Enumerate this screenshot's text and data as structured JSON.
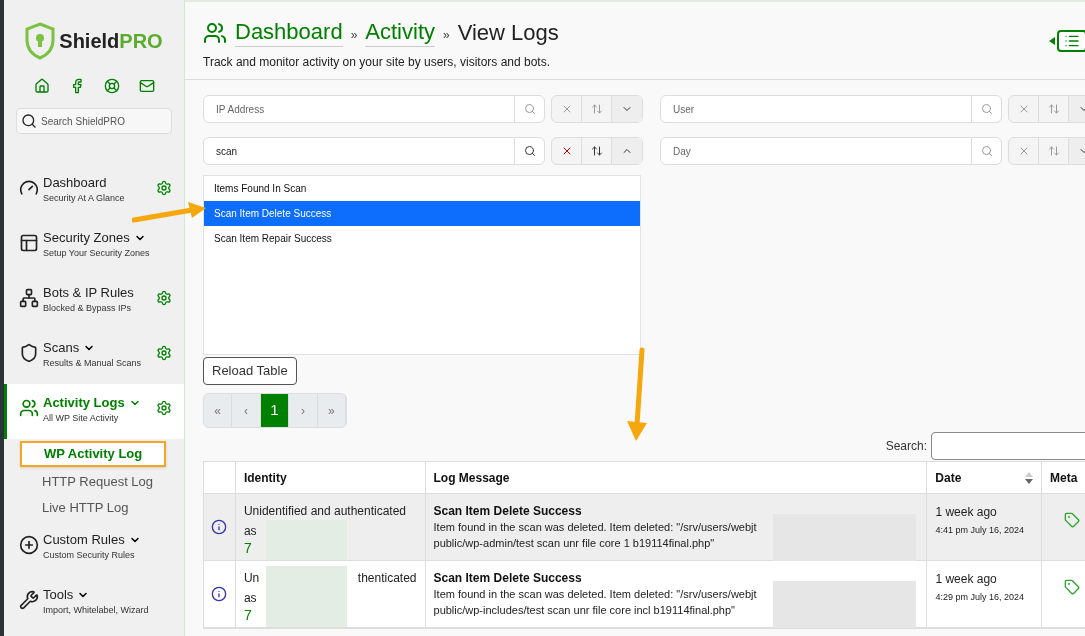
{
  "brand": {
    "name_start": "Shield",
    "name_end": "PRO"
  },
  "sidebar": {
    "search_placeholder": "Search ShieldPRO",
    "items": [
      {
        "kind": "gauge",
        "title": "Dashboard",
        "subtitle": "Security At A Glance",
        "dropdown": false,
        "settings": true,
        "selected": false
      },
      {
        "kind": "zones",
        "title": "Security Zones",
        "subtitle": "Setup Your Security Zones",
        "dropdown": true,
        "settings": false,
        "selected": false
      },
      {
        "kind": "network",
        "title": "Bots & IP Rules",
        "subtitle": "Blocked & Bypass IPs",
        "dropdown": false,
        "settings": true,
        "selected": false
      },
      {
        "kind": "shield",
        "title": "Scans",
        "subtitle": "Results & Manual Scans",
        "dropdown": true,
        "settings": true,
        "selected": false
      },
      {
        "kind": "users",
        "title": "Activity Logs",
        "subtitle": "All WP Site Activity",
        "dropdown": true,
        "settings": true,
        "selected": true,
        "children": [
          {
            "label": "WP Activity Log",
            "selected": true
          },
          {
            "label": "HTTP Request Log",
            "selected": false
          },
          {
            "label": "Live HTTP Log",
            "selected": false
          }
        ]
      },
      {
        "kind": "rules",
        "title": "Custom Rules",
        "subtitle": "Custom Security Rules",
        "dropdown": true,
        "settings": false,
        "selected": false
      },
      {
        "kind": "tools",
        "title": "Tools",
        "subtitle": "Import, Whitelabel, Wizard",
        "dropdown": true,
        "settings": false,
        "selected": false
      }
    ]
  },
  "breadcrumb": [
    {
      "label": "Dashboard",
      "link": true,
      "separator": "»"
    },
    {
      "label": "Activity",
      "link": true,
      "separator": "»"
    },
    {
      "label": "View Logs",
      "link": false
    }
  ],
  "description": "Track and monitor activity on your site by users, visitors and bots.",
  "filters": [
    {
      "placeholder": "IP Address",
      "expanded": false
    },
    {
      "placeholder": "User",
      "expanded": false
    },
    {
      "value": "scan",
      "expanded": true,
      "options": [
        {
          "label": "Items Found In Scan",
          "selected": false
        },
        {
          "label": "Scan Item Delete Success",
          "selected": true
        },
        {
          "label": "Scan Item Repair Success",
          "selected": false
        }
      ]
    },
    {
      "placeholder": "Day",
      "expanded": false
    }
  ],
  "reload_button": "Reload Table",
  "pagination": [
    {
      "label": "«",
      "selected": false
    },
    {
      "label": "‹",
      "selected": false
    },
    {
      "label": "1",
      "selected": true
    },
    {
      "label": "›",
      "selected": false
    },
    {
      "label": "»",
      "selected": false
    }
  ],
  "search_label": "Search:",
  "table": {
    "columns": [
      {
        "label": "Identity"
      },
      {
        "label": "Log Message"
      },
      {
        "label": "Date",
        "sortable": true
      },
      {
        "label": "Meta"
      }
    ],
    "rows": [
      {
        "identity": [
          "Unidentified and authenticated",
          "as",
          "7"
        ],
        "title": "Scan Item Delete Success",
        "message": [
          "Item found in the scan was deleted. Item deleted: \"/srv/users/webjt",
          "public/wp-admin/test scan unr file core 1 b19114final.php\""
        ],
        "ago": "1 week ago",
        "date": "4:41 pm July 16, 2024",
        "selected": true
      },
      {
        "identity": [
          "Un",
          "as",
          "7"
        ],
        "identity_tail": "thenticated",
        "title": "Scan Item Delete Success",
        "message": [
          "Item found in the scan was deleted. Item deleted: \"/srv/users/webjt",
          "public/wp-includes/test scan unr file core incl b19114final.php\""
        ],
        "ago": "1 week ago",
        "date": "4:29 pm July 16, 2024",
        "selected": false
      }
    ]
  }
}
